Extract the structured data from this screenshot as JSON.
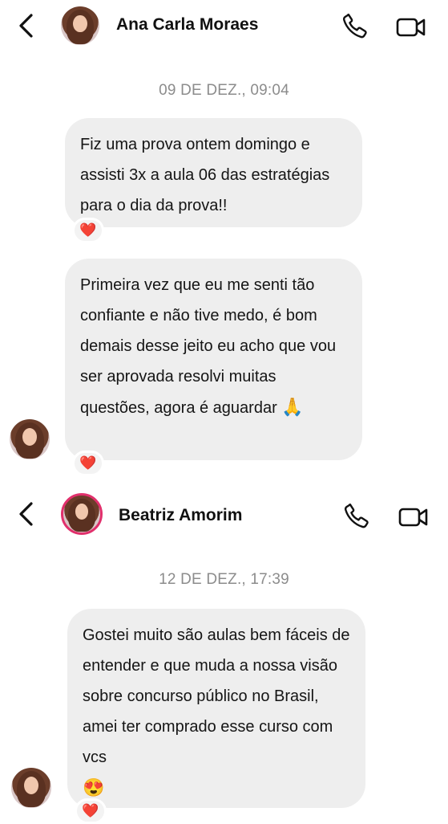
{
  "chat1": {
    "contact_name": "Ana Carla Moraes",
    "date": "09 DE DEZ., 09:04",
    "messages": [
      {
        "text": "Fiz uma prova ontem domingo e assisti 3x a aula 06 das estratégias para o dia da prova!!",
        "reaction": "❤️"
      },
      {
        "text": "Primeira vez que eu me senti tão confiante e não tive medo, é bom demais desse jeito eu acho que vou ser aprovada resolvi muitas questões, agora é aguardar",
        "emoji": "🙏",
        "reaction": "❤️"
      }
    ]
  },
  "chat2": {
    "contact_name": "Beatriz Amorim",
    "date": "12 DE DEZ., 17:39",
    "messages": [
      {
        "text": "Gostei muito são aulas bem fáceis de entender e que muda a nossa visão sobre concurso público no Brasil, amei ter comprado esse curso com vcs",
        "emoji": "😍",
        "reaction": "❤️"
      }
    ]
  },
  "icons": {
    "back": "chevron-left-icon",
    "call": "phone-icon",
    "video": "video-camera-icon",
    "reaction": "heart-icon"
  },
  "colors": {
    "bubble": "#eeeeee",
    "date": "#8c8c8c",
    "heart": "#e3162f",
    "story_ring": "#e1306c"
  }
}
